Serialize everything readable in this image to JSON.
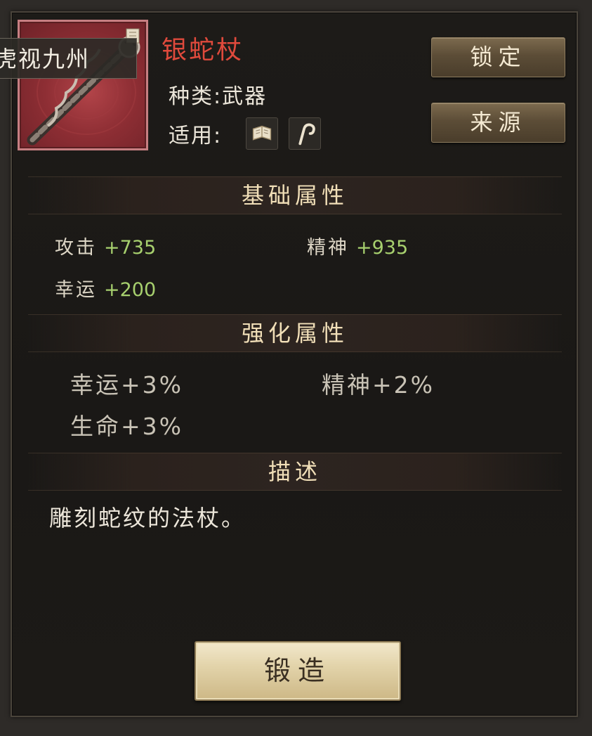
{
  "item": {
    "name": "银蛇杖",
    "type_line": "种类:武器",
    "apply_label": "适用:",
    "side_label": "虎视九州",
    "apply_icons": [
      "scroll-icon",
      "staff-hook-icon"
    ],
    "name_color": "#e04a3c"
  },
  "buttons": {
    "lock": "锁定",
    "source": "来源",
    "forge": "锻造"
  },
  "sections": {
    "base": "基础属性",
    "enhance": "强化属性",
    "desc": "描述"
  },
  "base_stats": [
    {
      "label": "攻击",
      "value": "+735"
    },
    {
      "label": "精神",
      "value": "+935"
    },
    {
      "label": "幸运",
      "value": "+200"
    }
  ],
  "enhance_stats": [
    "幸运+3%",
    "精神+2%",
    "生命+3%"
  ],
  "description": "雕刻蛇纹的法杖。",
  "colors": {
    "stat_value": "#a7d06e",
    "header_text": "#f1dfb8"
  }
}
